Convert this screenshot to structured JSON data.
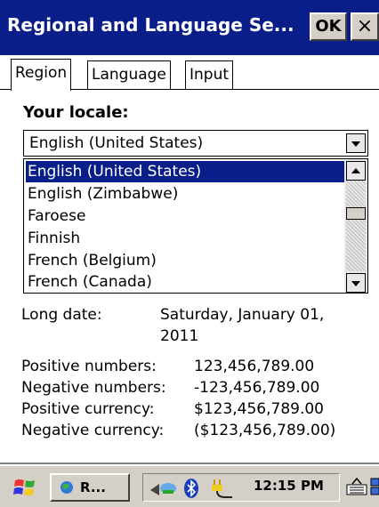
{
  "window": {
    "title": "Regional and Language Se...",
    "ok_label": "OK",
    "close_label": "×"
  },
  "tabs": [
    {
      "label": "Region",
      "active": true
    },
    {
      "label": "Language",
      "active": false
    },
    {
      "label": "Input",
      "active": false
    }
  ],
  "locale": {
    "heading": "Your locale:",
    "selected": "English (United States)",
    "options": [
      "English (United States)",
      "English (Zimbabwe)",
      "Faroese",
      "Finnish",
      "French (Belgium)",
      "French (Canada)"
    ]
  },
  "settings": {
    "long_date_label": "Long date:",
    "long_date_value_line1": "Saturday, January 01,",
    "long_date_value_line2": "2011",
    "positive_numbers_label": "Positive numbers:",
    "positive_numbers_value": "123,456,789.00",
    "negative_numbers_label": "Negative numbers:",
    "negative_numbers_value": "-123,456,789.00",
    "positive_currency_label": "Positive currency:",
    "positive_currency_value": "$123,456,789.00",
    "negative_currency_label": "Negative currency:",
    "negative_currency_value": "($123,456,789.00)"
  },
  "taskbar": {
    "task_label": "R...",
    "clock": "12:15 PM"
  },
  "colors": {
    "title_bar": "#0a1e8a",
    "selection": "#0a1e8a"
  }
}
